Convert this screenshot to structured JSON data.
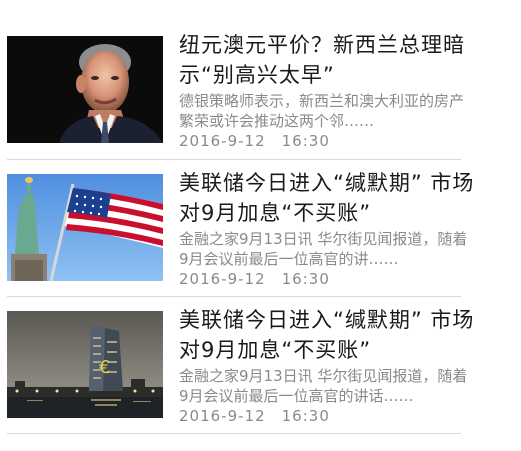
{
  "feed": {
    "items": [
      {
        "title": "纽元澳元平价？新西兰总理暗示“别高兴太早”",
        "summary": "德银策略师表示，新西兰和澳大利亚的房产繁荣或许会推动这两个邻……",
        "date": "2016-9-12",
        "time": "16:30",
        "thumbnail": "politician-portrait"
      },
      {
        "title": "美联储今日进入“缄默期” 市场对9月加息“不买账”",
        "summary": "金融之家9月13日讯 华尔街见闻报道，随着9月会议前最后一位高官的讲……",
        "date": "2016-9-12",
        "time": "16:30",
        "thumbnail": "statue-of-liberty-us-flag"
      },
      {
        "title": "美联储今日进入“缄默期” 市场对9月加息“不买账”",
        "summary": "金融之家9月13日讯 华尔街见闻报道，随着9月会议前最后一位高官的讲话……",
        "date": "2016-9-12",
        "time": "16:30",
        "thumbnail": "ecb-tower-night"
      }
    ]
  }
}
